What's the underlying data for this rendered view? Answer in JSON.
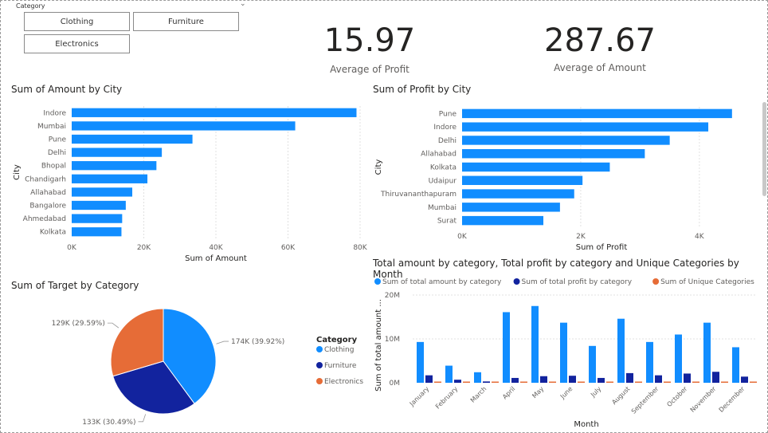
{
  "slicer": {
    "title": "Category",
    "options": [
      "Clothing",
      "Furniture",
      "Electronics"
    ]
  },
  "kpis": {
    "profit": {
      "value": "15.97",
      "label": "Average of Profit"
    },
    "amount": {
      "value": "287.67",
      "label": "Average of Amount"
    }
  },
  "colors": {
    "blue": "#118dff",
    "navy": "#12239e",
    "orange": "#e66c37",
    "grid": "#e0e0e0",
    "text": "#605e5c"
  },
  "chart_data": [
    {
      "id": "amount_by_city",
      "type": "bar",
      "orientation": "horizontal",
      "title": "Sum of Amount by City",
      "xlabel": "Sum of Amount",
      "ylabel": "City",
      "categories": [
        "Indore",
        "Mumbai",
        "Pune",
        "Delhi",
        "Bhopal",
        "Chandigarh",
        "Allahabad",
        "Bangalore",
        "Ahmedabad",
        "Kolkata"
      ],
      "values": [
        79000,
        62000,
        33500,
        25000,
        23500,
        21000,
        16800,
        15000,
        14000,
        13800
      ],
      "xlim": [
        0,
        80000
      ],
      "xticks": [
        "0K",
        "20K",
        "40K",
        "60K",
        "80K"
      ],
      "grid": true
    },
    {
      "id": "profit_by_city",
      "type": "bar",
      "orientation": "horizontal",
      "title": "Sum of Profit by City",
      "xlabel": "Sum of Profit",
      "ylabel": "City",
      "categories": [
        "Pune",
        "Indore",
        "Delhi",
        "Allahabad",
        "Kolkata",
        "Udaipur",
        "Thiruvananthapuram",
        "Mumbai",
        "Surat"
      ],
      "values": [
        4550,
        4150,
        3500,
        3080,
        2490,
        2030,
        1890,
        1650,
        1370
      ],
      "xlim": [
        0,
        4700
      ],
      "xticks": [
        {
          "label": "0K",
          "v": 0
        },
        {
          "label": "2K",
          "v": 2000
        },
        {
          "label": "4K",
          "v": 4000
        }
      ],
      "grid": true
    },
    {
      "id": "target_by_category",
      "type": "pie",
      "title": "Sum of Target by Category",
      "legend_title": "Category",
      "legend_position": "right",
      "slices": [
        {
          "name": "Clothing",
          "label": "174K (39.92%)",
          "percent": 39.92
        },
        {
          "name": "Furniture",
          "label": "133K (30.49%)",
          "percent": 30.49
        },
        {
          "name": "Electronics",
          "label": "129K (29.59%)",
          "percent": 29.59
        }
      ]
    },
    {
      "id": "by_month",
      "type": "bar",
      "title": "Total amount by category, Total profit by category and Unique Categories by Month",
      "xlabel": "Month",
      "ylabel": "Sum of total amount ...",
      "ylim": [
        0,
        20000000
      ],
      "yticks": [
        {
          "label": "0M",
          "v": 0
        },
        {
          "label": "10M",
          "v": 10000000
        },
        {
          "label": "20M",
          "v": 20000000
        }
      ],
      "legend_position": "top",
      "categories": [
        "January",
        "February",
        "March",
        "April",
        "May",
        "June",
        "July",
        "August",
        "September",
        "October",
        "November",
        "December"
      ],
      "series": [
        {
          "name": "Sum of total amount by category",
          "values": [
            9300000,
            3900000,
            2400000,
            16100000,
            17500000,
            13700000,
            8400000,
            14600000,
            9300000,
            11000000,
            13700000,
            8100000
          ]
        },
        {
          "name": "Sum of total profit by category",
          "values": [
            1700000,
            700000,
            300000,
            1100000,
            1500000,
            1600000,
            1100000,
            2200000,
            1700000,
            2100000,
            2500000,
            1400000
          ]
        },
        {
          "name": "Sum of Unique Categories",
          "values": [
            3,
            3,
            3,
            3,
            3,
            3,
            3,
            3,
            3,
            3,
            3,
            3
          ]
        }
      ]
    }
  ]
}
